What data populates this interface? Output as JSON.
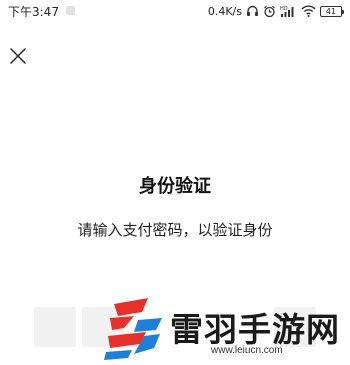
{
  "status_bar": {
    "time": "下午3:47",
    "net_speed": "0.4K/s",
    "signal_label": "HD",
    "battery_level": "41",
    "icons": [
      "headphones-icon",
      "alarm-icon",
      "signal-icon",
      "wifi-icon",
      "battery-icon"
    ]
  },
  "header": {
    "close_icon": "close-icon"
  },
  "main": {
    "title": "身份验证",
    "subtitle": "请输入支付密码，以验证身份"
  },
  "watermark": {
    "name": "雷羽手游网",
    "url": "www.leiucn.com",
    "colors": {
      "red": "#e8302a",
      "blue": "#1e7fd9"
    }
  }
}
